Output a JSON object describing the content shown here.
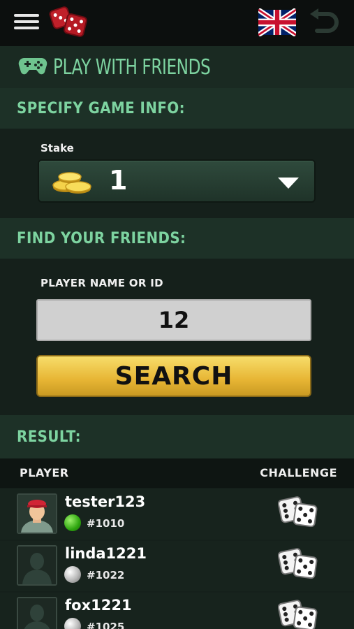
{
  "header": {
    "menu_icon": "hamburger-menu-icon",
    "logo_icon": "red-dice-logo",
    "language_icon": "uk-flag-icon",
    "back_icon": "back-arrow-icon"
  },
  "title": {
    "icon": "gamepad-icon",
    "text": "PLAY WITH FRIENDS"
  },
  "game_info": {
    "heading": "SPECIFY GAME INFO:",
    "stake_label": "Stake",
    "stake_value": "1",
    "stake_icon": "gold-coins-icon"
  },
  "find_friends": {
    "heading": "FIND YOUR FRIENDS:",
    "input_label": "PLAYER NAME OR ID",
    "input_value": "12",
    "search_label": "SEARCH"
  },
  "result": {
    "heading": "RESULT:",
    "col_player": "PLAYER",
    "col_challenge": "CHALLENGE",
    "rows": [
      {
        "name": "tester123",
        "id": "#1010",
        "status": "online",
        "avatar": "custom-avatar"
      },
      {
        "name": "linda1221",
        "id": "#1022",
        "status": "offline",
        "avatar": "default-silhouette"
      },
      {
        "name": "fox1221",
        "id": "#1025",
        "status": "offline",
        "avatar": "default-silhouette"
      }
    ]
  },
  "colors": {
    "accent": "#7dd3a0",
    "search_button": "#e7b534",
    "background": "#15201b",
    "online": "#2ea50f",
    "offline": "#b8b8b8"
  }
}
